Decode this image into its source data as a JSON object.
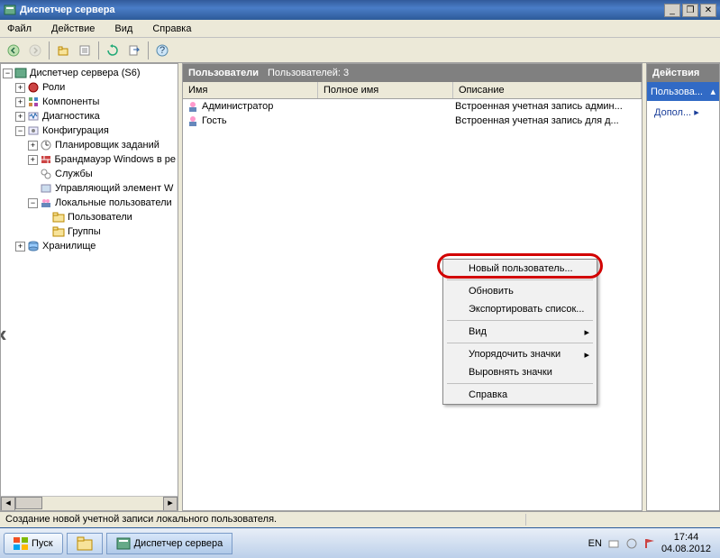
{
  "window": {
    "title": "Диспетчер сервера"
  },
  "menu": {
    "file": "Файл",
    "action": "Действие",
    "view": "Вид",
    "help": "Справка"
  },
  "tree": {
    "root": "Диспетчер сервера (S6)",
    "roles": "Роли",
    "components": "Компоненты",
    "diagnostics": "Диагностика",
    "configuration": "Конфигурация",
    "task_scheduler": "Планировщик заданий",
    "firewall": "Брандмауэр Windows в ре",
    "services": "Службы",
    "wmi": "Управляющий элемент W",
    "local_users": "Локальные пользователи",
    "users": "Пользователи",
    "groups": "Группы",
    "storage": "Хранилище"
  },
  "list": {
    "header_title": "Пользователи",
    "header_count": "Пользователей: 3",
    "col_name": "Имя",
    "col_fullname": "Полное имя",
    "col_desc": "Описание",
    "rows": [
      {
        "name": "Администратор",
        "full": "",
        "desc": "Встроенная учетная запись админ..."
      },
      {
        "name": "Гость",
        "full": "",
        "desc": "Встроенная учетная запись для д..."
      }
    ]
  },
  "actions": {
    "title": "Действия",
    "sub": "Пользова...",
    "extra": "Допол..."
  },
  "context_menu": {
    "new_user": "Новый пользователь...",
    "refresh": "Обновить",
    "export": "Экспортировать список...",
    "view": "Вид",
    "arrange": "Упорядочить значки",
    "align": "Выровнять значки",
    "help": "Справка"
  },
  "status": "Создание новой учетной записи локального пользователя.",
  "taskbar": {
    "start": "Пуск",
    "app": "Диспетчер сервера",
    "lang": "EN",
    "time": "17:44",
    "date": "04.08.2012"
  }
}
